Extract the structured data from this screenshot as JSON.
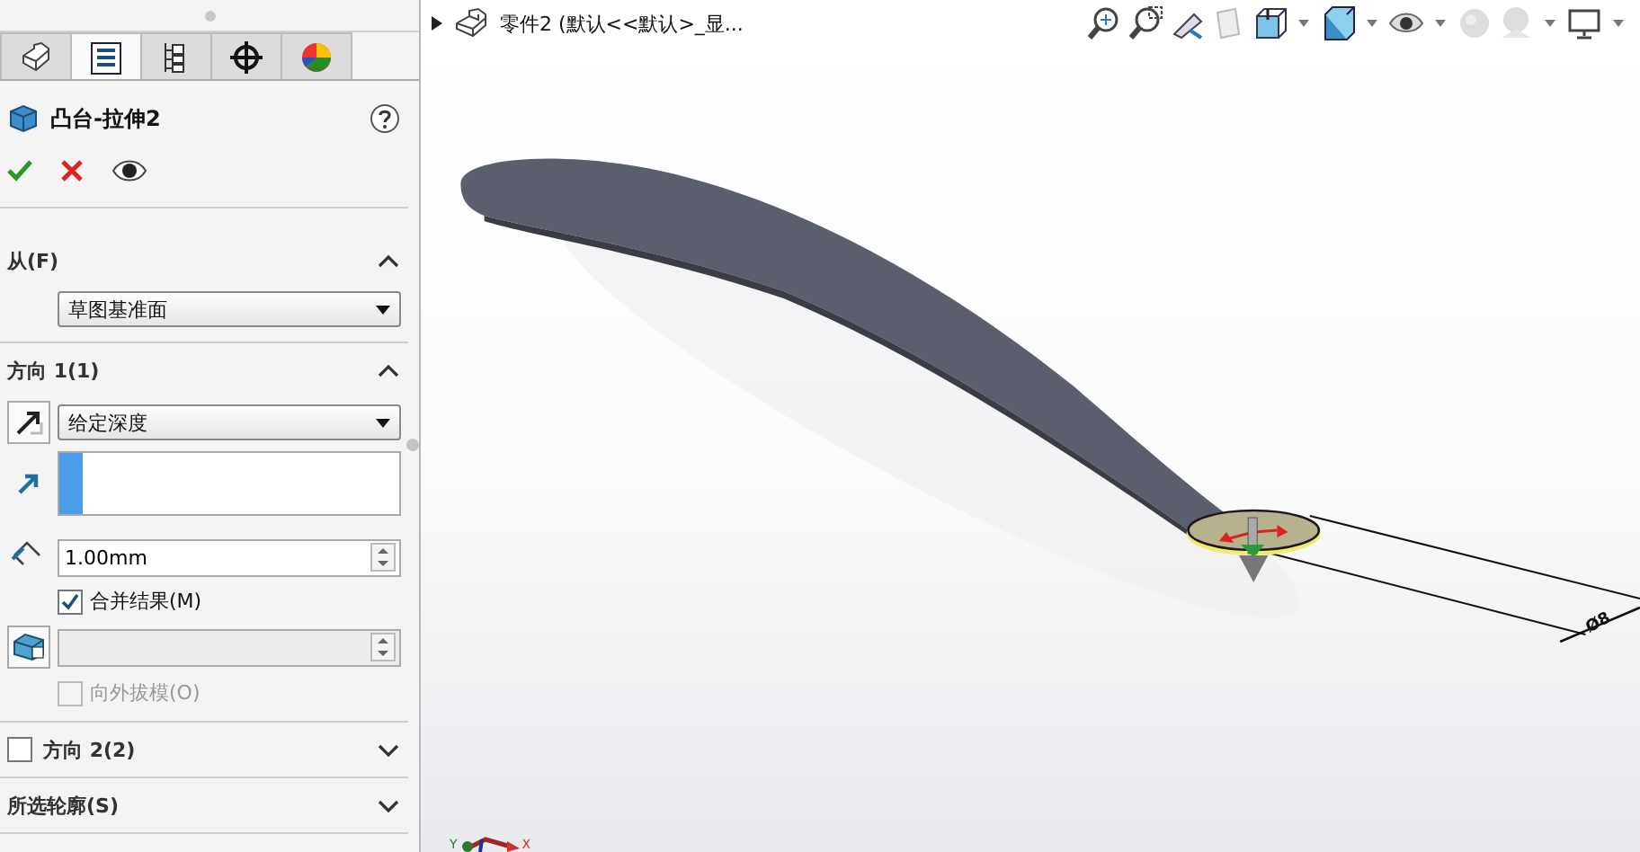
{
  "panel": {
    "tabs": [
      {
        "selected": false
      },
      {
        "selected": true
      },
      {
        "selected": false
      },
      {
        "selected": false
      },
      {
        "selected": false
      }
    ],
    "title": "凸台-拉伸2",
    "sections": [
      {
        "title": "从(F)",
        "expanded": true,
        "rows": [
          {
            "kind": "plain-dropdown",
            "value": "草图基准面"
          }
        ]
      },
      {
        "title": "方向 1(1)",
        "expanded": true,
        "rows": [
          {
            "kind": "end-condition",
            "value": "给定深度"
          },
          {
            "kind": "direction"
          },
          {
            "kind": "depth",
            "value": "1.00mm"
          },
          {
            "kind": "checkbox",
            "label": "合并结果(M)",
            "checked": true,
            "disabled": false
          },
          {
            "kind": "draft"
          },
          {
            "kind": "checkbox",
            "label": "向外拔模(O)",
            "checked": false,
            "disabled": true
          }
        ]
      },
      {
        "title": "方向 2(2)",
        "expanded": false,
        "checkbox": {
          "checked": false
        }
      },
      {
        "title": "所选轮廓(S)",
        "expanded": false
      }
    ]
  },
  "viewport": {
    "breadcrumb": "零件2  (默认<<默认>_显...",
    "dimension": "Ø8",
    "axes": [
      "Y",
      "X"
    ]
  }
}
